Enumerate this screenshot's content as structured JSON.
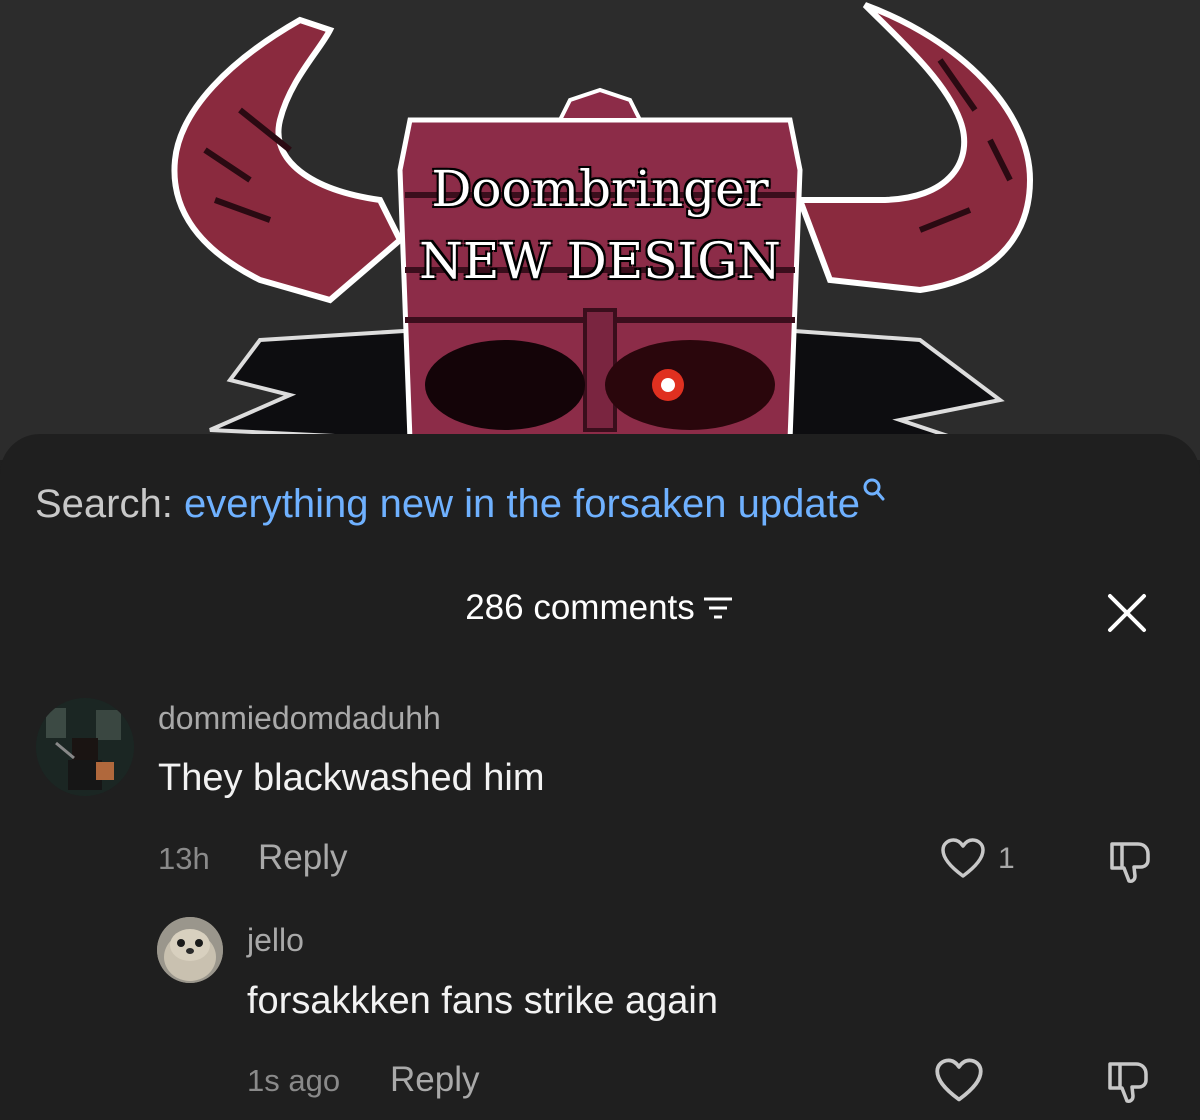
{
  "video": {
    "title_line1": "Doombringer",
    "title_line2": "NEW DESIGN"
  },
  "search": {
    "label": "Search:",
    "query": "everything new in the forsaken update"
  },
  "comments_header": {
    "count_label": "286 comments"
  },
  "comments": [
    {
      "username": "dommiedomdaduhh",
      "text": "They blackwashed him",
      "time": "13h",
      "reply_label": "Reply",
      "likes": "1"
    },
    {
      "username": "jello",
      "text": "forsakkken fans strike again",
      "time": "1s ago",
      "reply_label": "Reply"
    }
  ],
  "colors": {
    "background": "#1f1f1f",
    "search_query": "#6fb1ff",
    "muted_text": "#a9a9a9"
  }
}
